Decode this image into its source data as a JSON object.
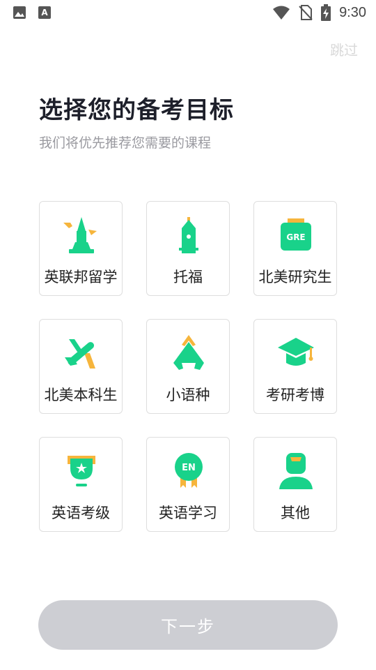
{
  "status_bar": {
    "time": "9:30",
    "left_icons": [
      "image-icon",
      "font-icon"
    ],
    "right_icons": [
      "wifi-icon",
      "no-sim-icon",
      "battery-charging-icon"
    ]
  },
  "skip_label": "跳过",
  "title": "选择您的备考目标",
  "subtitle": "我们将优先推荐您需要的课程",
  "goals": [
    {
      "label": "英联邦留学",
      "icon": "big-ben-icon"
    },
    {
      "label": "托福",
      "icon": "tower-icon"
    },
    {
      "label": "北美研究生",
      "icon": "gre-book-icon"
    },
    {
      "label": "北美本科生",
      "icon": "airplane-icon"
    },
    {
      "label": "小语种",
      "icon": "mountain-icon"
    },
    {
      "label": "考研考博",
      "icon": "graduation-cap-icon"
    },
    {
      "label": "英语考级",
      "icon": "trophy-icon"
    },
    {
      "label": "英语学习",
      "icon": "en-medal-icon"
    },
    {
      "label": "其他",
      "icon": "person-icon"
    }
  ],
  "next_label": "下一步",
  "colors": {
    "accent_green": "#19d28a",
    "accent_orange": "#f6b53c",
    "disabled_button": "#cdced3"
  }
}
